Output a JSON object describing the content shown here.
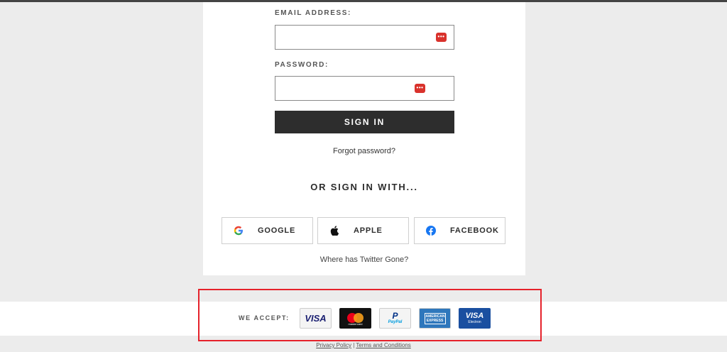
{
  "form": {
    "email_label": "EMAIL ADDRESS:",
    "email_value": "",
    "password_label": "PASSWORD:",
    "password_value": "",
    "signin_label": "SIGN IN",
    "forgot_label": "Forgot password?",
    "or_label": "OR SIGN IN WITH...",
    "twitter_label": "Where has Twitter Gone?"
  },
  "social": {
    "google": "GOOGLE",
    "apple": "APPLE",
    "facebook": "FACEBOOK"
  },
  "payments": {
    "label": "WE ACCEPT:",
    "visa": "VISA",
    "mastercard": "mastercard",
    "paypal": "PayPal",
    "amex": "AMERICAN EXPRESS",
    "visa_electron": "VISA",
    "visa_electron_sub": "Electron"
  },
  "footer": {
    "privacy": "Privacy Policy",
    "separator": "|",
    "terms": "Terms and Conditions"
  },
  "colors": {
    "highlight": "#e5222b",
    "button": "#2d2d2d",
    "background": "#ececec"
  }
}
